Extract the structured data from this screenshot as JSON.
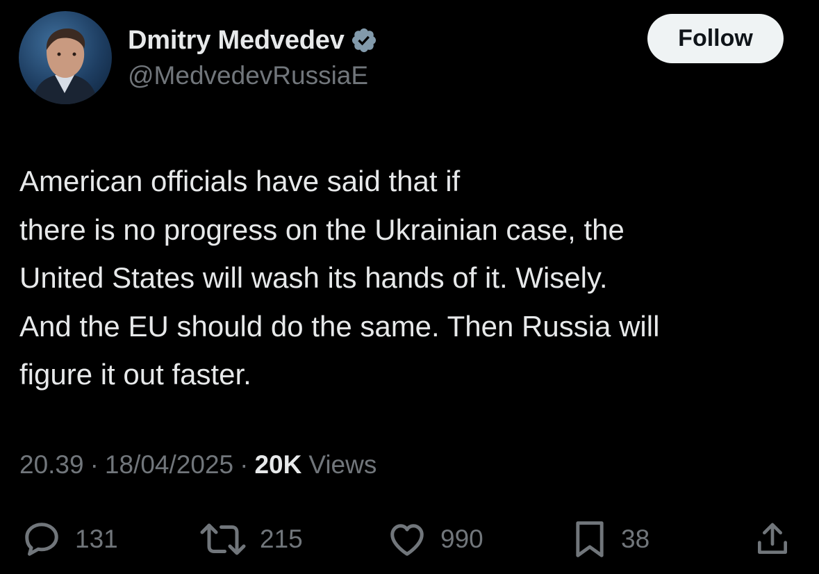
{
  "user": {
    "display_name": "Dmitry Medvedev",
    "handle": "@MedvedevRussiaE",
    "verified_badge_icon": "verified-badge-icon",
    "verified_color": "#829aab"
  },
  "follow_button": {
    "label": "Follow"
  },
  "tweet": {
    "lines": [
      "American officials have said that if",
      "there is no progress on the Ukrainian case, the",
      "United States will wash its hands of it. Wisely.",
      "And the EU should do the same. Then Russia will",
      "figure it out faster."
    ]
  },
  "meta": {
    "time": "20.39",
    "separator": "·",
    "date": "18/04/2025",
    "views_count": "20K",
    "views_label": "Views"
  },
  "actions": {
    "replies": {
      "icon": "reply-icon",
      "count": "131"
    },
    "reposts": {
      "icon": "repost-icon",
      "count": "215"
    },
    "likes": {
      "icon": "like-icon",
      "count": "990"
    },
    "bookmarks": {
      "icon": "bookmark-icon",
      "count": "38"
    },
    "share": {
      "icon": "share-icon"
    }
  },
  "colors": {
    "background": "#000000",
    "primary_text": "#e7e9ea",
    "secondary_text": "#71767b",
    "follow_button_bg": "#eff3f4"
  }
}
